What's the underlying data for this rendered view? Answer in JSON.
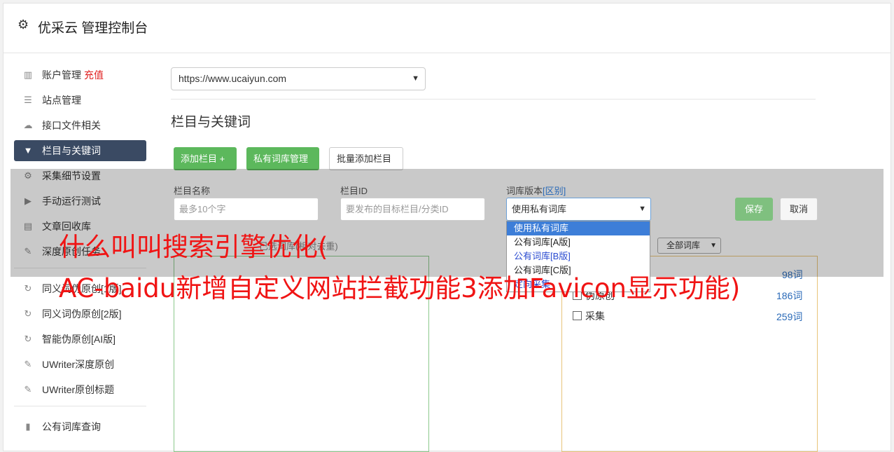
{
  "header": {
    "title": "优采云 管理控制台",
    "icon": "gear-icon"
  },
  "sidebar": {
    "items": [
      {
        "label": "账户管理",
        "extra": "充值",
        "icon": "bar-chart-icon"
      },
      {
        "label": "站点管理",
        "icon": "server-icon"
      },
      {
        "label": "接口文件相关",
        "icon": "cloud-upload-icon"
      },
      {
        "label": "栏目与关键词",
        "icon": "filter-icon",
        "active": true
      },
      {
        "label": "采集细节设置",
        "icon": "cogs-icon"
      },
      {
        "label": "手动运行测试",
        "icon": "play-icon"
      },
      {
        "label": "文章回收库",
        "icon": "database-icon"
      },
      {
        "label": "深度原创任务",
        "icon": "edit-icon"
      },
      {
        "label": "同义词伪原创[1版]",
        "icon": "refresh-icon"
      },
      {
        "label": "同义词伪原创[2版]",
        "icon": "refresh-icon"
      },
      {
        "label": "智能伪原创[AI版]",
        "icon": "refresh-icon"
      },
      {
        "label": "UWriter深度原创",
        "icon": "edit-icon"
      },
      {
        "label": "UWriter原创标题",
        "icon": "edit-icon"
      },
      {
        "label": "公有词库查询",
        "icon": "book-icon"
      }
    ]
  },
  "main": {
    "site_select": "https://www.ucaiyun.com",
    "section_title": "栏目与关键词",
    "buttons": {
      "add": "添加栏目 +",
      "private_lib": "私有词库管理",
      "batch_add": "批量添加栏目"
    },
    "form": {
      "name_label": "栏目名称",
      "name_placeholder": "最多10个字",
      "id_label": "栏目ID",
      "id_placeholder": "要发布的目标栏目/分类ID",
      "version_label": "词库版本",
      "version_link": "[区别]",
      "version_value": "使用私有词库",
      "save": "保存",
      "cancel": "取消"
    },
    "dropdown_options": [
      "使用私有词库",
      "公有词库[A版]",
      "公有词库[B版]",
      "公有词库[C版]",
      "定向采集"
    ],
    "left_panel_caption": "已选词库(相对去重)",
    "filter_value": "全部词库",
    "right_list": [
      {
        "label": "伪原创",
        "count": "186词"
      },
      {
        "label": "采集",
        "count": "259词"
      }
    ],
    "right_partial_count": "98词"
  },
  "watermark": {
    "line1": "什么叫叫搜索引擎优化(",
    "line2": "AC-baidu新增自定义网站拦截功能3添加Favicon显示功能)",
    "color": "#f01414"
  }
}
